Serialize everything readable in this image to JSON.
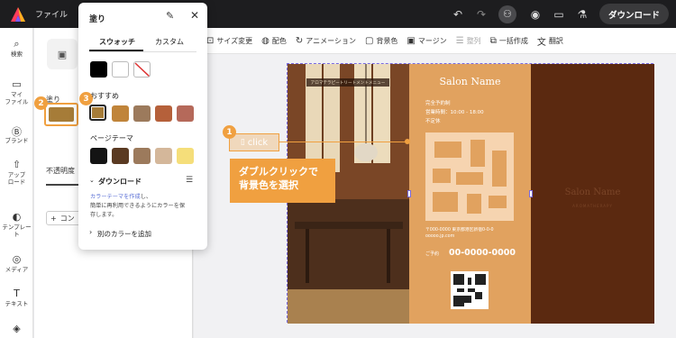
{
  "topbar": {
    "file_label": "ファイル",
    "download_label": "ダウンロード",
    "icons": [
      "undo-icon",
      "redo-icon",
      "account-icon",
      "location-icon",
      "comment-icon",
      "lab-icon"
    ]
  },
  "rail": {
    "items": [
      {
        "label": "検索",
        "icon": "⌕"
      },
      {
        "label": "マイ\nファイル",
        "icon": "▭"
      },
      {
        "label": "ブランド",
        "icon": "B"
      },
      {
        "label": "アップ\nロード",
        "icon": "⇧"
      },
      {
        "label": "テンプレート",
        "icon": "◐"
      },
      {
        "label": "メディア",
        "icon": "◎"
      },
      {
        "label": "テキスト",
        "icon": "T"
      },
      {
        "label": "",
        "icon": "◈"
      }
    ]
  },
  "sidepanel": {
    "fill_label": "塗り",
    "opacity_label": "不透明度",
    "add_label": "コン"
  },
  "toolbar": {
    "items": [
      {
        "label": "サイズ変更",
        "icon": "⊡",
        "disabled": false
      },
      {
        "label": "配色",
        "icon": "◍",
        "disabled": false
      },
      {
        "label": "アニメーション",
        "icon": "↻",
        "disabled": false
      },
      {
        "label": "背景色",
        "icon": "▢",
        "disabled": false
      },
      {
        "label": "マージン",
        "icon": "▣",
        "disabled": false
      },
      {
        "label": "整列",
        "icon": "☰",
        "disabled": true
      },
      {
        "label": "一括作成",
        "icon": "⧉",
        "disabled": false
      },
      {
        "label": "翻訳",
        "icon": "文",
        "disabled": false
      }
    ]
  },
  "popup": {
    "title": "塗り",
    "tab_swatch": "スウォッチ",
    "tab_custom": "カスタム",
    "recommended_label": "おすすめ",
    "page_theme_label": "ページテーマ",
    "download_label": "ダウンロード",
    "helper_link": "カラーテーマを作成",
    "helper_text_1": "し、",
    "helper_text_2": "簡単に再利用できるようにカラーを保",
    "helper_text_3": "存します。",
    "add_color_label": "別のカラーを追加",
    "basic_colors": [
      "#000000",
      "#ffffff",
      "none"
    ],
    "recommended_colors": [
      "#a67c38",
      "#c0843a",
      "#9c7a5c",
      "#b5603a",
      "#b5695a"
    ],
    "theme_colors": [
      "#141414",
      "#5a3a22",
      "#9c7a5c",
      "#d4b79a",
      "#f5de7a"
    ]
  },
  "brochure": {
    "menu_banner": "アロマテラピートリートメントメニュー",
    "salon_title": "Salon Name",
    "info_line_1": "完全予約制",
    "info_line_2": "営業時間：10:00 - 18:00",
    "info_line_3": "不定休",
    "address_line_1": "〒000-0000 東京都港区新宿0-0-0",
    "address_line_2": "ooooo.jp.com",
    "phone_prefix": "ご予約",
    "phone": "00-0000-0000",
    "back_title": "Salon Name",
    "back_sub": "AROMATHERAPY"
  },
  "annotations": {
    "step1": "1",
    "step2": "2",
    "step3": "3",
    "click_label": "click",
    "tooltip_line_1": "ダブルクリックで",
    "tooltip_line_2": "背景色を選択"
  },
  "colors": {
    "accent": "#f0a040",
    "brochure_orange": "#e1a25f",
    "brochure_brown": "#5b2910",
    "selection": "#7a6be0"
  }
}
